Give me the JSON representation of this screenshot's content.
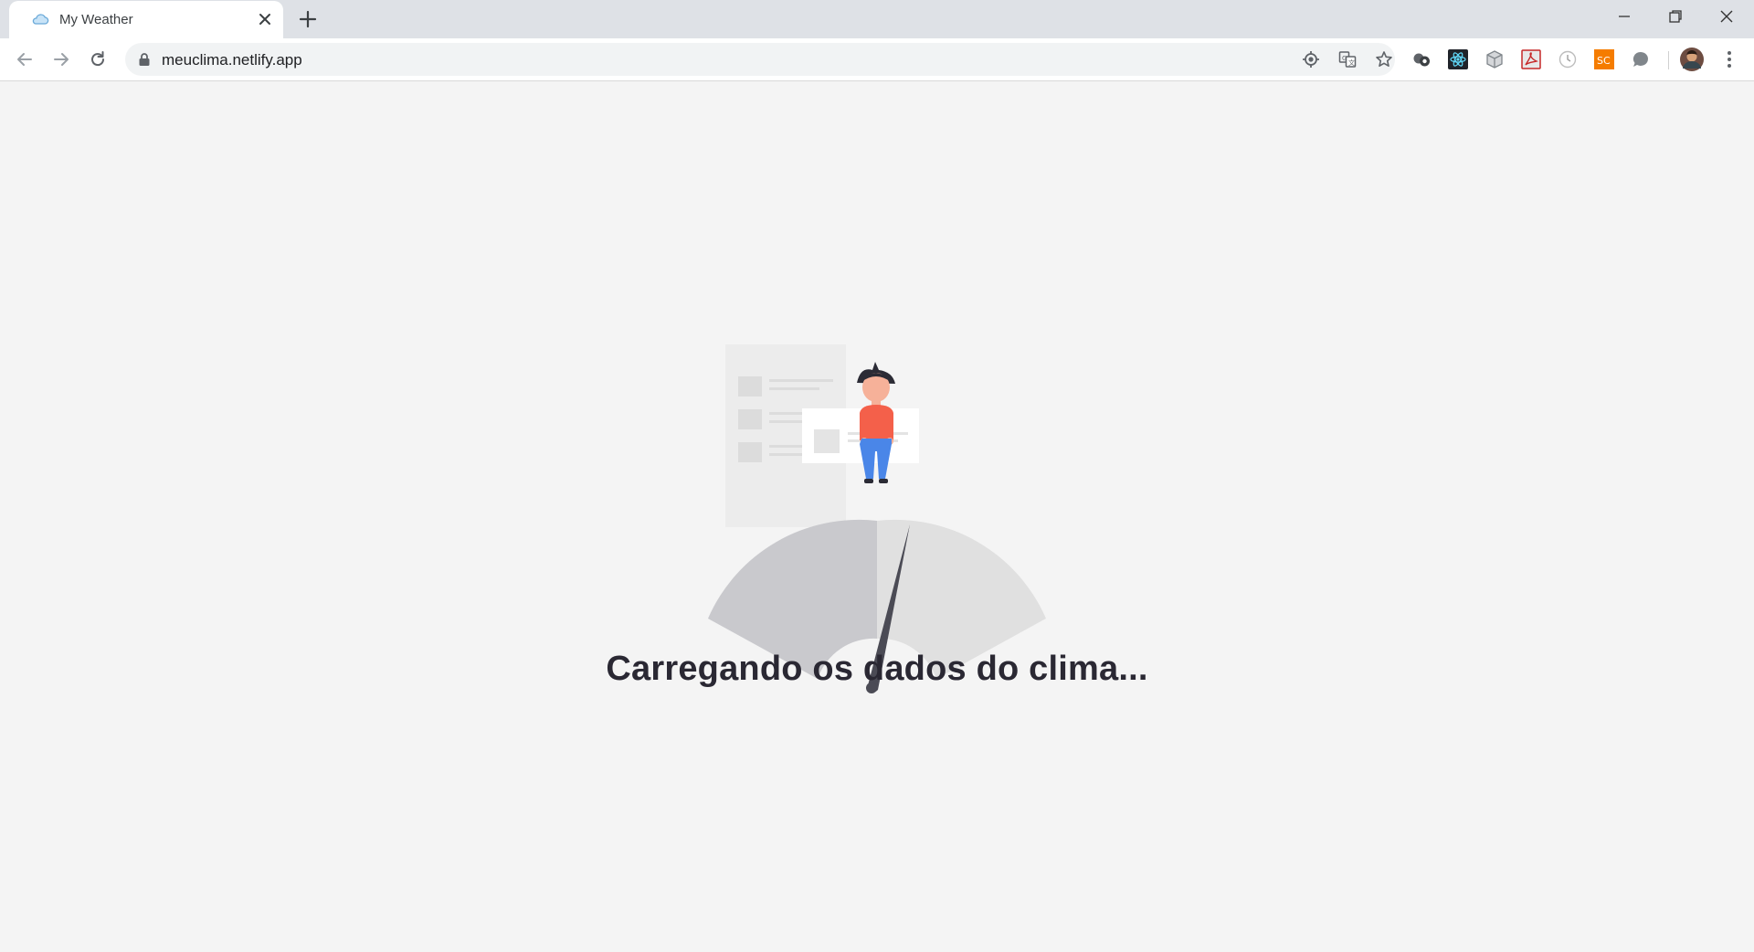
{
  "browser": {
    "tab": {
      "title": "My Weather",
      "favicon": "cloud-icon"
    },
    "address_bar": {
      "url": "meuclima.netlify.app"
    },
    "extensions": [
      "extension-icon",
      "react-devtools-icon",
      "cube-extension-icon",
      "pdf-extension-icon",
      "clock-extension-icon",
      "sc-extension-icon",
      "chat-extension-icon"
    ],
    "extension_label_sc": "SC"
  },
  "page": {
    "loading_message": "Carregando os dados do clima..."
  },
  "colors": {
    "accent_person_shirt": "#f4604a",
    "accent_person_pants": "#4a86e8",
    "gauge_left": "#c9c9cd",
    "gauge_right": "#e0e0e0",
    "needle": "#4b4b55",
    "text": "#2a2833"
  }
}
